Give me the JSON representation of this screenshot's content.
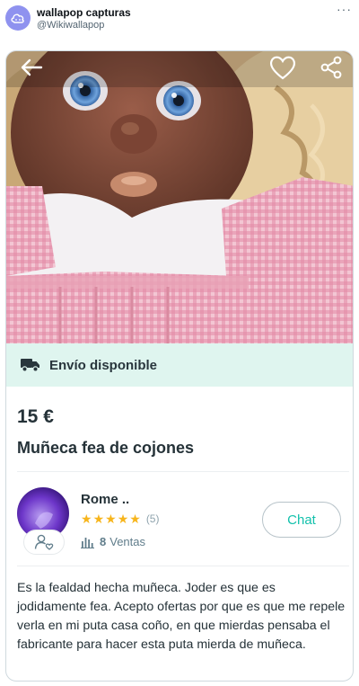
{
  "tweet": {
    "name": "wallapop capturas",
    "handle": "@Wikiwallapop",
    "more_label": "···"
  },
  "listing": {
    "shipping": "Envío disponible",
    "price": "15 €",
    "title": "Muñeca fea de cojones",
    "seller": {
      "name": "Rome ..",
      "stars": 5,
      "reviews": "(5)",
      "sales_count": "8",
      "sales_label": "Ventas"
    },
    "chat_label": "Chat",
    "description": "Es la fealdad hecha muñeca. Joder es que es jodidamente fea. Acepto ofertas por que es que me repele verla en mi puta casa coño, en que mierdas pensaba el fabricante para hacer esta puta mierda de muñeca."
  },
  "icons": {
    "back": "back-arrow-icon",
    "favorite": "heart-icon",
    "share": "share-icon",
    "shipping": "truck-icon",
    "sales": "bar-chart-icon",
    "badge": "user-heart-icon"
  },
  "colors": {
    "accent": "#13c1ac",
    "shipping_bg": "#dff5ef",
    "star": "#f7b51c",
    "twitter_avatar": "#8f92ef"
  }
}
